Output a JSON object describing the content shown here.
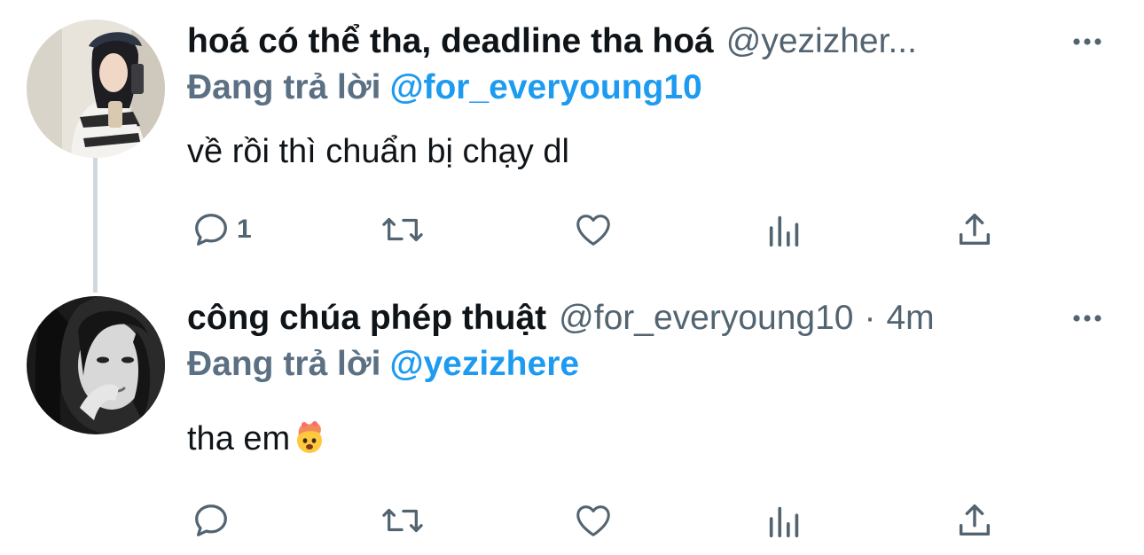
{
  "tweets": [
    {
      "display_name": "hoá có thể tha, deadline tha hoá",
      "handle": "@yezizher...",
      "reply_prefix": "Đang trả lời",
      "reply_to": "@for_everyoung10",
      "text": "về rồi thì chuẩn bị chạy dl",
      "reply_count": "1",
      "avatar_icon": "profile-photo-girl-cap"
    },
    {
      "display_name": "công chúa phép thuật",
      "handle": "@for_everyoung10",
      "separator": "·",
      "time": "4m",
      "reply_prefix": "Đang trả lời",
      "reply_to": "@yezizhere",
      "text": "tha em",
      "emoji": "exploding-head-emoji",
      "reply_count": "",
      "avatar_icon": "profile-photo-girl-bw"
    }
  ],
  "colors": {
    "text": "#0f1419",
    "secondary": "#536471",
    "link": "#1d9bf0",
    "icon": "#536471",
    "thread_line": "#cfd9de"
  }
}
